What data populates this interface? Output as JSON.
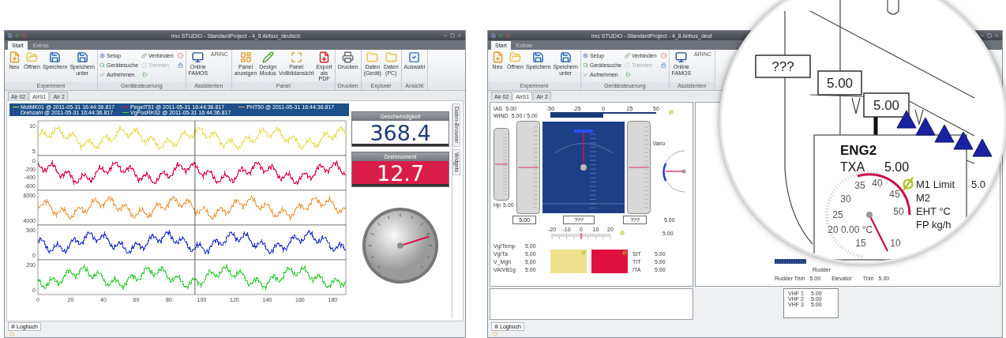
{
  "left_window": {
    "title": "imc STUDIO - StandardProject - 4_8 Airbus_deutsch",
    "menu_tabs": [
      {
        "label": "Start",
        "selected": true
      },
      {
        "label": "Extras",
        "selected": false
      }
    ],
    "ribbon": [
      {
        "label": "Experiment",
        "items": [
          {
            "label": "Neu",
            "kind": "large"
          },
          {
            "label": "Öffnen",
            "kind": "large"
          },
          {
            "label": "Speichern",
            "kind": "large"
          },
          {
            "label": "Speichern unter",
            "kind": "large"
          }
        ]
      },
      {
        "label": "Gerätesteuerung",
        "items": [
          {
            "label": "Setup",
            "kind": "small",
            "disabled": false
          },
          {
            "label": "Gerätesuche",
            "kind": "small",
            "disabled": false
          },
          {
            "label": "Aufnehmen",
            "kind": "small",
            "disabled": false
          },
          {
            "label": "Verbinden",
            "kind": "small",
            "disabled": false
          },
          {
            "label": "Trennen",
            "kind": "small",
            "disabled": true
          },
          {
            "kind": "icon"
          },
          {
            "kind": "icon"
          },
          {
            "kind": "icon"
          }
        ]
      },
      {
        "label": "Assistenten",
        "items": [
          {
            "label": "Online FAMOS",
            "kind": "large"
          },
          {
            "label": "ARINC",
            "kind": "text"
          }
        ]
      },
      {
        "label": "Panel",
        "items": [
          {
            "label": "Panel anzeigen",
            "kind": "large"
          },
          {
            "label": "Design Modus",
            "kind": "large"
          },
          {
            "label": "Panel Vollbildansicht",
            "kind": "large"
          },
          {
            "label": "Export als PDF",
            "kind": "large"
          }
        ]
      },
      {
        "label": "Drucken",
        "items": [
          {
            "label": "Drucken",
            "kind": "large"
          }
        ]
      },
      {
        "label": "Explorer",
        "items": [
          {
            "label": "Daten (Gerät)",
            "kind": "large"
          },
          {
            "label": "Daten (PC)",
            "kind": "large"
          }
        ]
      },
      {
        "label": "Ansicht",
        "items": [
          {
            "label": "Auswahl",
            "kind": "large"
          }
        ]
      }
    ],
    "doc_tabs": [
      {
        "label": "Air 02",
        "selected": false
      },
      {
        "label": "AirS1",
        "selected": true
      },
      {
        "label": "Air 2",
        "selected": false
      }
    ],
    "legend": [
      {
        "label": "MotMK01 @ 2011-05-31 16:44:36.817",
        "color": "#e8e060"
      },
      {
        "label": "PegelT51 @ 2011-05-31 16:44:36.817",
        "color": "#e0105a"
      },
      {
        "label": "PHT50 @ 2011-05-31 16:44:36.817",
        "color": "#f0a050"
      },
      {
        "label": "Drehzahl @ 2011-05-31 16:44:36.817",
        "color": "#3040d0"
      },
      {
        "label": "VgPosRK02 @ 2011-05-31 16:44:36.817",
        "color": "#40d040"
      }
    ],
    "panels": [
      {
        "color": "#e8e060",
        "yticks": [
          "10",
          "5"
        ]
      },
      {
        "color": "#e0105a",
        "yticks": [
          "0",
          "-200",
          "-400",
          "-600"
        ]
      },
      {
        "color": "#f0a050",
        "yticks": [
          "6000",
          "4000"
        ]
      },
      {
        "color": "#3040d0",
        "yticks": [
          "500",
          "0"
        ]
      },
      {
        "color": "#40d040",
        "yticks": [
          "200",
          "0"
        ]
      }
    ],
    "xticks": [
      "0",
      "20",
      "40",
      "60",
      "80",
      "100",
      "120",
      "140",
      "160",
      "180"
    ],
    "displays": [
      {
        "title": "Geschwindigkeit",
        "value": "368.4",
        "kind": "normal"
      },
      {
        "title": "Drehmoment",
        "value": "12.7",
        "kind": "alarm"
      }
    ],
    "side_tabs": [
      "Daten-Browser",
      "Widgets"
    ],
    "log_tab": "Logbuch"
  },
  "right_window": {
    "title": "imc STUDIO - StandardProject - 4_8 Airbus_deut",
    "menu_tabs": [
      {
        "label": "Start",
        "selected": true
      },
      {
        "label": "Extras",
        "selected": false
      }
    ],
    "ribbon": [
      {
        "label": "Experiment",
        "items": [
          {
            "label": "Neu",
            "kind": "large"
          },
          {
            "label": "Öffnen",
            "kind": "large"
          },
          {
            "label": "Speichern",
            "kind": "large"
          },
          {
            "label": "Speichern unter",
            "kind": "large"
          }
        ]
      },
      {
        "label": "Gerätesteuerung",
        "items": [
          {
            "label": "Setup",
            "kind": "small",
            "disabled": false
          },
          {
            "label": "Gerätesuche",
            "kind": "small",
            "disabled": false
          },
          {
            "label": "Aufnehmen",
            "kind": "small",
            "disabled": false
          },
          {
            "label": "Verbinden",
            "kind": "small",
            "disabled": false
          },
          {
            "label": "Trennen",
            "kind": "small",
            "disabled": true
          },
          {
            "kind": "icon"
          },
          {
            "kind": "icon"
          },
          {
            "kind": "icon"
          }
        ]
      },
      {
        "label": "Assistenten",
        "items": [
          {
            "label": "Online FAMOS",
            "kind": "large"
          },
          {
            "label": "ARINC",
            "kind": "text"
          }
        ]
      }
    ],
    "doc_tabs": [
      {
        "label": "Air 02",
        "selected": false
      },
      {
        "label": "AirS1",
        "selected": true
      },
      {
        "label": "Air 2",
        "selected": false
      }
    ],
    "ias": {
      "label": "IAS",
      "value": "5.00"
    },
    "wind": {
      "label": "WIND",
      "value": "5.00 / 5.00"
    },
    "wind_scale": [
      "-50",
      "-25",
      "0",
      "25",
      "50"
    ],
    "hp": {
      "label": "Hp",
      "value": "5.00"
    },
    "vario_label": "Vario",
    "readouts": [
      "5.00",
      "???",
      "???"
    ],
    "side_values": [
      "5.00",
      "5.00"
    ],
    "trim_scale": [
      "-20",
      "-10",
      "0",
      "10",
      "20"
    ],
    "rows_left": [
      {
        "label": "Vg/Temp",
        "value": "5.00"
      },
      {
        "label": "Vg/Ta",
        "value": "5.00"
      },
      {
        "label": "V_Mgh",
        "value": "5.00"
      },
      {
        "label": "VA/VB1g",
        "value": "5.00"
      }
    ],
    "rows_right": [
      {
        "label": "SIT",
        "value": "5.00"
      },
      {
        "label": "TIT",
        "value": "5.00"
      },
      {
        "label": "ITA",
        "value": "5.00"
      }
    ],
    "rudder_label": "Rudder",
    "trims": [
      {
        "label": "Rudder Trim",
        "value": "5.00"
      },
      {
        "label": "Elevator"
      },
      {
        "label": "Trim",
        "value": "5.00"
      }
    ],
    "vhf": [
      {
        "label": "VHF 1",
        "value": "5.00"
      },
      {
        "label": "VHF 2",
        "value": "5.00"
      },
      {
        "label": "VHF 3",
        "value": "5.00"
      }
    ],
    "log_tab": "Logbuch"
  },
  "magnifier": {
    "boxes": [
      "???",
      "5.00",
      "5.00"
    ],
    "engine": "ENG2",
    "param": {
      "label": "TXA",
      "value": "5.00"
    },
    "gauge_ticks": [
      "10",
      "15",
      "20",
      "25",
      "30",
      "35",
      "40",
      "45",
      "50"
    ],
    "gauge_value": "0.00 °C",
    "legend": [
      "M1 Limit",
      "M2",
      "EHT °C",
      "FP kg/h"
    ],
    "legend_value": "5.0"
  }
}
